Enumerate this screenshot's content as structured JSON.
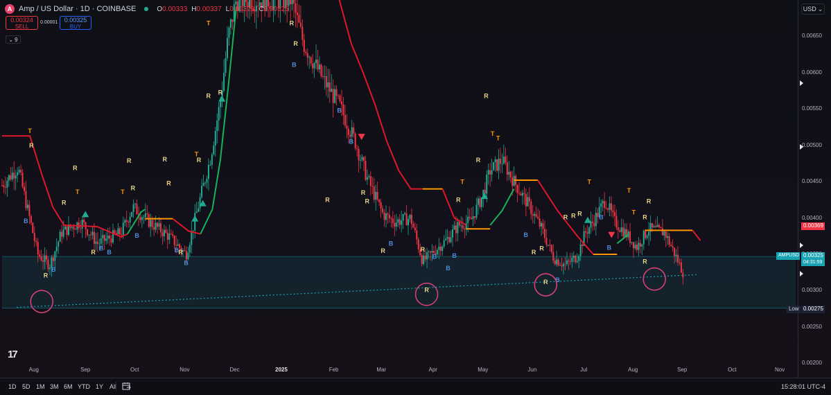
{
  "header": {
    "logo_glyph": "A",
    "symbol": "Amp / US Dollar · 1D · COINBASE",
    "ohlc": {
      "o_label": "O",
      "o": "0.00333",
      "h_label": "H",
      "h": "0.00337",
      "l_label": "L",
      "l": "0.00323",
      "c_label": "C",
      "c": "0.00325"
    }
  },
  "trade": {
    "sell_price": "0.00324",
    "sell_label": "SELL",
    "spread": "0.00001",
    "buy_price": "0.00325",
    "buy_label": "BUY",
    "indicators_count": "9"
  },
  "currency": "USD",
  "price_tags": {
    "level_red": "0.00369",
    "symbol": "AMPUSD",
    "current": "0.00325",
    "countdown": "04:31:59",
    "low_label": "Low",
    "low": "0.00275"
  },
  "bottom_bar": {
    "ranges": [
      "1D",
      "5D",
      "1M",
      "3M",
      "6M",
      "YTD",
      "1Y",
      "All"
    ],
    "clock": "15:28:01 UTC-4"
  },
  "colors": {
    "up": "#22ab94",
    "down": "#f23645",
    "trail_red": "#e0162b",
    "trail_green": "#16b35a",
    "orange": "#ff9800",
    "teal": "#1aa3b3",
    "pink": "#e0417a",
    "blue": "#2962ff",
    "letter_R": "#e8d48a",
    "letter_B": "#4c8cdb",
    "letter_T": "#ff9800"
  },
  "chart_data": {
    "type": "candlestick",
    "title": "Amp / US Dollar · 1D · COINBASE",
    "x_labels": [
      "Aug",
      "Sep",
      "Oct",
      "Nov",
      "Dec",
      "2025",
      "Feb",
      "Mar",
      "Apr",
      "May",
      "Jun",
      "Jul",
      "Aug",
      "Sep",
      "Oct",
      "Nov"
    ],
    "y_ticks": [
      "0.00650",
      "0.00600",
      "0.00550",
      "0.00500",
      "0.00450",
      "0.00400",
      "0.00350",
      "0.00300",
      "0.00250",
      "0.00200"
    ],
    "ylim": [
      0.00185,
      0.007
    ],
    "grid": false,
    "trend_line_support": [
      {
        "x": "2024-08-05",
        "y": 0.00277
      },
      {
        "x": "2025-09-27",
        "y": 0.00322
      }
    ],
    "support_zone": {
      "y_top": 0.00347,
      "y_bottom": 0.00276
    },
    "trailing_stop_segments": [
      {
        "color": "red",
        "points": [
          [
            0.0,
            0.00513
          ],
          [
            0.035,
            0.00513
          ],
          [
            0.05,
            0.0046
          ],
          [
            0.064,
            0.00415
          ],
          [
            0.078,
            0.0039
          ],
          [
            0.12,
            0.00388
          ],
          [
            0.15,
            0.00374
          ],
          [
            0.158,
            0.00378
          ]
        ]
      },
      {
        "color": "green",
        "points": [
          [
            0.158,
            0.00378
          ],
          [
            0.175,
            0.00408
          ],
          [
            0.18,
            0.00412
          ]
        ]
      },
      {
        "color": "orange",
        "points": [
          [
            0.18,
            0.00399
          ],
          [
            0.215,
            0.00399
          ]
        ]
      },
      {
        "color": "red",
        "points": [
          [
            0.215,
            0.00399
          ],
          [
            0.235,
            0.00382
          ],
          [
            0.25,
            0.00378
          ]
        ]
      },
      {
        "color": "green",
        "points": [
          [
            0.25,
            0.00378
          ],
          [
            0.265,
            0.00412
          ],
          [
            0.275,
            0.0048
          ],
          [
            0.285,
            0.0058
          ],
          [
            0.295,
            0.0069
          ]
        ]
      },
      {
        "color": "red",
        "points": [
          [
            0.425,
            0.007
          ],
          [
            0.44,
            0.0064
          ],
          [
            0.455,
            0.006
          ],
          [
            0.47,
            0.00556
          ],
          [
            0.485,
            0.00505
          ],
          [
            0.5,
            0.00465
          ],
          [
            0.515,
            0.0044
          ],
          [
            0.53,
            0.0044
          ]
        ]
      },
      {
        "color": "orange",
        "points": [
          [
            0.53,
            0.0044
          ],
          [
            0.555,
            0.0044
          ]
        ]
      },
      {
        "color": "red",
        "points": [
          [
            0.555,
            0.0044
          ],
          [
            0.57,
            0.004
          ],
          [
            0.585,
            0.0039
          ]
        ]
      },
      {
        "color": "orange",
        "points": [
          [
            0.585,
            0.00385
          ],
          [
            0.615,
            0.00385
          ]
        ]
      },
      {
        "color": "green",
        "points": [
          [
            0.615,
            0.0039
          ],
          [
            0.63,
            0.0041
          ],
          [
            0.645,
            0.0044
          ]
        ]
      },
      {
        "color": "orange",
        "points": [
          [
            0.645,
            0.00452
          ],
          [
            0.675,
            0.00452
          ]
        ]
      },
      {
        "color": "red",
        "points": [
          [
            0.675,
            0.00452
          ],
          [
            0.7,
            0.0041
          ],
          [
            0.725,
            0.00375
          ],
          [
            0.745,
            0.0035
          ]
        ]
      },
      {
        "color": "orange",
        "points": [
          [
            0.745,
            0.0035
          ],
          [
            0.775,
            0.0035
          ]
        ]
      },
      {
        "color": "green",
        "points": [
          [
            0.775,
            0.00365
          ],
          [
            0.79,
            0.00378
          ]
        ]
      },
      {
        "color": "orange",
        "points": [
          [
            0.81,
            0.00383
          ],
          [
            0.87,
            0.00383
          ]
        ]
      },
      {
        "color": "red",
        "points": [
          [
            0.87,
            0.00383
          ],
          [
            0.88,
            0.00369
          ]
        ]
      }
    ],
    "signal_markers": [
      {
        "label": "T",
        "x": 0.035,
        "y": 0.00517
      },
      {
        "label": "R",
        "x": 0.037,
        "y": 0.00497
      },
      {
        "label": "B",
        "x": 0.03,
        "y": 0.00393
      },
      {
        "label": "R",
        "x": 0.078,
        "y": 0.00418
      },
      {
        "label": "R",
        "x": 0.092,
        "y": 0.00466
      },
      {
        "label": "T",
        "x": 0.095,
        "y": 0.00433
      },
      {
        "label": "R",
        "x": 0.055,
        "y": 0.00318
      },
      {
        "label": "B",
        "x": 0.065,
        "y": 0.00326
      },
      {
        "label": "R",
        "x": 0.115,
        "y": 0.0035
      },
      {
        "label": "B",
        "x": 0.125,
        "y": 0.00355
      },
      {
        "label": "B",
        "x": 0.135,
        "y": 0.0035
      },
      {
        "label": "R",
        "x": 0.16,
        "y": 0.00476
      },
      {
        "label": "R",
        "x": 0.165,
        "y": 0.00438
      },
      {
        "label": "T",
        "x": 0.152,
        "y": 0.00433
      },
      {
        "label": "B",
        "x": 0.17,
        "y": 0.00373
      },
      {
        "label": "R",
        "x": 0.205,
        "y": 0.00478
      },
      {
        "label": "R",
        "x": 0.21,
        "y": 0.00445
      },
      {
        "label": "B",
        "x": 0.22,
        "y": 0.00353
      },
      {
        "label": "R",
        "x": 0.225,
        "y": 0.0035
      },
      {
        "label": "B",
        "x": 0.232,
        "y": 0.00335
      },
      {
        "label": "T",
        "x": 0.245,
        "y": 0.00485
      },
      {
        "label": "R",
        "x": 0.248,
        "y": 0.00477
      },
      {
        "label": "T",
        "x": 0.26,
        "y": 0.00665
      },
      {
        "label": "R",
        "x": 0.26,
        "y": 0.00565
      },
      {
        "label": "R",
        "x": 0.275,
        "y": 0.0057
      },
      {
        "label": "R",
        "x": 0.365,
        "y": 0.00665
      },
      {
        "label": "R",
        "x": 0.37,
        "y": 0.00637
      },
      {
        "label": "B",
        "x": 0.368,
        "y": 0.00608
      },
      {
        "label": "R",
        "x": 0.41,
        "y": 0.00422
      },
      {
        "label": "B",
        "x": 0.425,
        "y": 0.00545
      },
      {
        "label": "B",
        "x": 0.44,
        "y": 0.00502
      },
      {
        "label": "R",
        "x": 0.455,
        "y": 0.00432
      },
      {
        "label": "R",
        "x": 0.46,
        "y": 0.0042
      },
      {
        "label": "R",
        "x": 0.48,
        "y": 0.00352
      },
      {
        "label": "B",
        "x": 0.49,
        "y": 0.00362
      },
      {
        "label": "R",
        "x": 0.53,
        "y": 0.00354
      },
      {
        "label": "B",
        "x": 0.545,
        "y": 0.00344
      },
      {
        "label": "R",
        "x": 0.535,
        "y": 0.00298
      },
      {
        "label": "B",
        "x": 0.57,
        "y": 0.00345
      },
      {
        "label": "B",
        "x": 0.562,
        "y": 0.00328
      },
      {
        "label": "R",
        "x": 0.575,
        "y": 0.00422
      },
      {
        "label": "T",
        "x": 0.58,
        "y": 0.00447
      },
      {
        "label": "R",
        "x": 0.6,
        "y": 0.00477
      },
      {
        "label": "R",
        "x": 0.61,
        "y": 0.00565
      },
      {
        "label": "T",
        "x": 0.618,
        "y": 0.00513
      },
      {
        "label": "T",
        "x": 0.625,
        "y": 0.00507
      },
      {
        "label": "B",
        "x": 0.66,
        "y": 0.00374
      },
      {
        "label": "R",
        "x": 0.67,
        "y": 0.0035
      },
      {
        "label": "R",
        "x": 0.68,
        "y": 0.00355
      },
      {
        "label": "R",
        "x": 0.685,
        "y": 0.00309
      },
      {
        "label": "B",
        "x": 0.7,
        "y": 0.00312
      },
      {
        "label": "T",
        "x": 0.74,
        "y": 0.00447
      },
      {
        "label": "R",
        "x": 0.71,
        "y": 0.00398
      },
      {
        "label": "R",
        "x": 0.72,
        "y": 0.004
      },
      {
        "label": "R",
        "x": 0.728,
        "y": 0.00403
      },
      {
        "label": "B",
        "x": 0.755,
        "y": 0.00398
      },
      {
        "label": "B",
        "x": 0.765,
        "y": 0.00356
      },
      {
        "label": "T",
        "x": 0.79,
        "y": 0.00435
      },
      {
        "label": "T",
        "x": 0.796,
        "y": 0.00405
      },
      {
        "label": "R",
        "x": 0.81,
        "y": 0.00398
      },
      {
        "label": "R",
        "x": 0.815,
        "y": 0.0042
      },
      {
        "label": "R",
        "x": 0.81,
        "y": 0.00337
      }
    ],
    "trend_triangles": [
      {
        "dir": "up",
        "x": 0.105,
        "y": 0.00405
      },
      {
        "dir": "up",
        "x": 0.243,
        "y": 0.00399
      },
      {
        "dir": "up",
        "x": 0.253,
        "y": 0.0042
      },
      {
        "dir": "up",
        "x": 0.277,
        "y": 0.00564
      },
      {
        "dir": "down",
        "x": 0.453,
        "y": 0.00512
      },
      {
        "dir": "up",
        "x": 0.608,
        "y": 0.0043
      },
      {
        "dir": "up",
        "x": 0.738,
        "y": 0.00397
      },
      {
        "dir": "down",
        "x": 0.768,
        "y": 0.00377
      }
    ],
    "highlight_circles": [
      {
        "x": 0.05,
        "y": 0.00285
      },
      {
        "x": 0.535,
        "y": 0.00295
      },
      {
        "x": 0.685,
        "y": 0.00308
      },
      {
        "x": 0.822,
        "y": 0.00316
      }
    ]
  }
}
